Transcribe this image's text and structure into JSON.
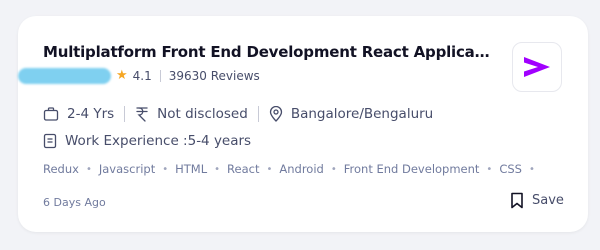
{
  "job": {
    "title": "Multiplatform Front End Development React Application...",
    "rating": "4.1",
    "reviews": "39630 Reviews",
    "experience": "2-4 Yrs",
    "salary": "Not disclosed",
    "location": "Bangalore/Bengaluru",
    "work_experience": "Work Experience :5-4 years",
    "tags": [
      "Redux",
      "Javascript",
      "HTML",
      "React",
      "Android",
      "Front End Development",
      "CSS"
    ],
    "posted": "6 Days Ago",
    "save_label": "Save"
  },
  "icons": {
    "star": "star-icon",
    "briefcase": "briefcase-icon",
    "rupee": "rupee-icon",
    "location": "location-pin-icon",
    "document": "document-icon",
    "bookmark": "bookmark-icon",
    "logo": "company-logo"
  },
  "colors": {
    "star": "#f5a623",
    "logo": "#a100ff",
    "redacted": "#7fd0f0"
  }
}
